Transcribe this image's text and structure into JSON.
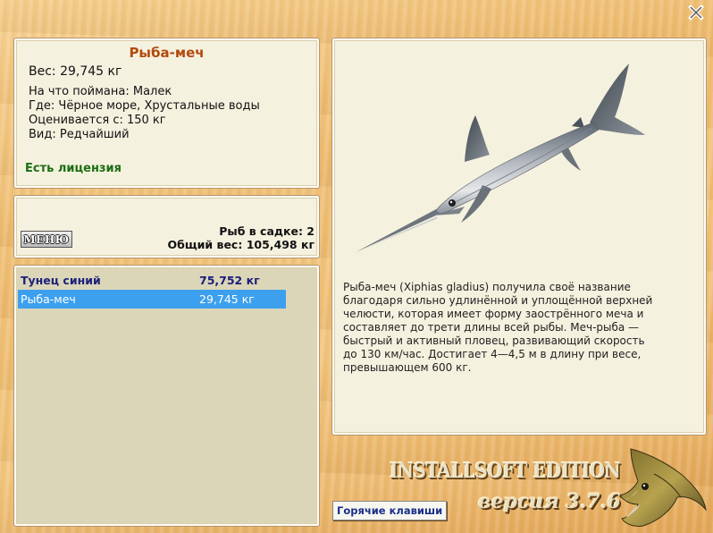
{
  "fish": {
    "name": "Рыба-меч",
    "weight": "Вес: 29,745 кг",
    "caught_on": "На что поймана: Малек",
    "location": "Где: Чёрное море, Хрустальные воды",
    "valued_from": "Оценивается с: 150 кг",
    "rarity": "Вид: Редчайший",
    "license": "Есть лицензия"
  },
  "keepnet": {
    "menu_label": "МЕНЮ",
    "fish_count": "Рыб в садке: 2",
    "total_weight": "Общий вес: 105,498 кг"
  },
  "catch_list": [
    {
      "name": "Тунец синий",
      "weight": "75,752 кг"
    },
    {
      "name": "Рыба-меч",
      "weight": "29,745 кг"
    }
  ],
  "description": "Рыба-меч (Xiphias gladius) получила своё название благодаря сильно удлинённой и уплощённой верхней челюсти, которая имеет форму заострённого меча и составляет до трети длины всей рыбы. Меч-рыба — быстрый и активный пловец, развивающий скорость до 130 км/час. Достигает 4—4,5 м в длину при весе, превышающем 600 кг.",
  "hotkeys_label": "Горячие клавиши",
  "branding": {
    "edition": "INSTALLSOFT EDITION",
    "version": "версия 3.7.6"
  },
  "icons": [
    "close-icon",
    "swordfish-image",
    "pike-logo-icon"
  ],
  "colors": {
    "title": "#b34a0c",
    "license": "#1b6e12",
    "selected_row": "#3da0ee",
    "list_text": "#1b1f7a"
  }
}
